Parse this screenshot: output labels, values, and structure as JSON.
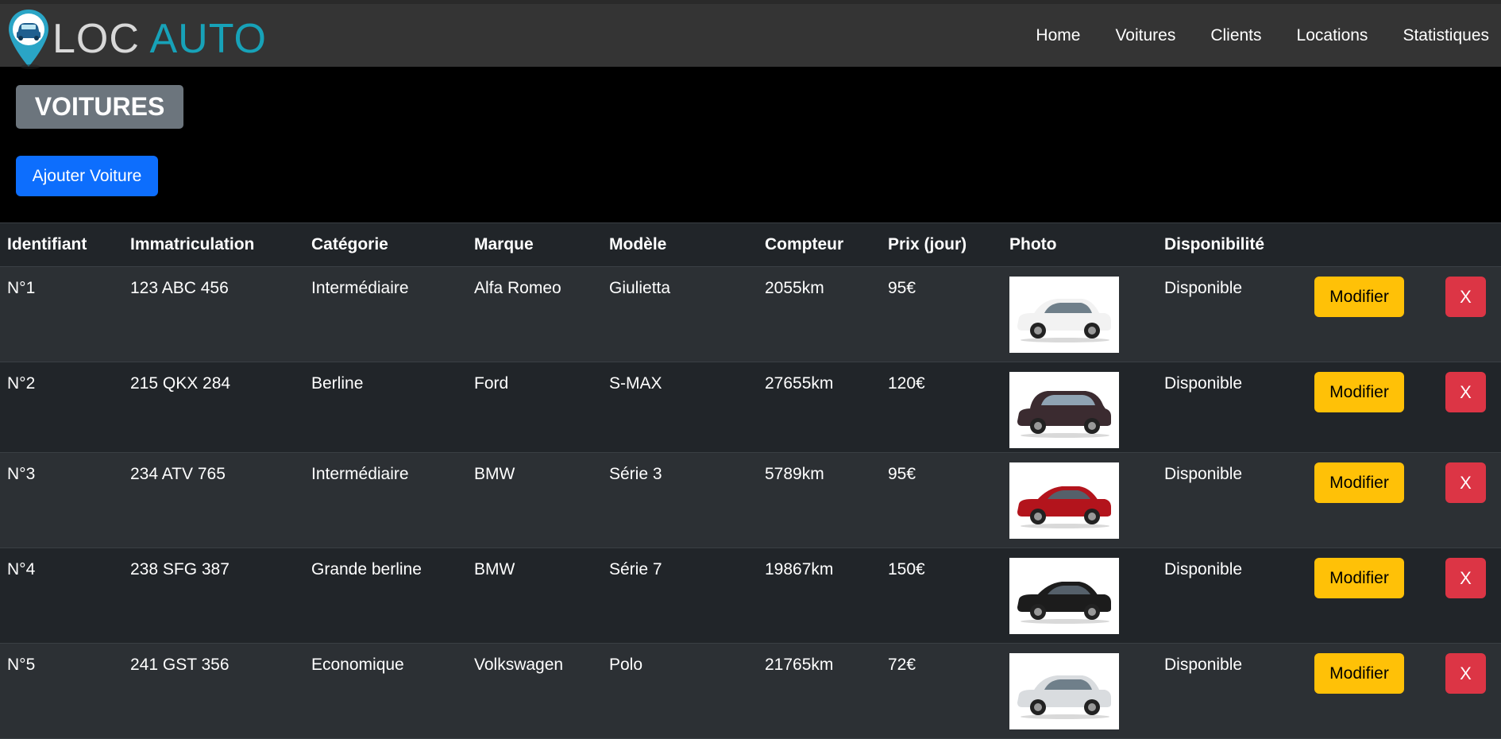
{
  "logo": {
    "word1": "LOC",
    "word2": "AUTO"
  },
  "nav": {
    "items": [
      "Home",
      "Voitures",
      "Clients",
      "Locations",
      "Statistiques"
    ]
  },
  "page": {
    "title": "VOITURES",
    "add_button": "Ajouter Voiture"
  },
  "table": {
    "headers": {
      "id": "Identifiant",
      "plate": "Immatriculation",
      "category": "Catégorie",
      "brand": "Marque",
      "model": "Modèle",
      "mileage": "Compteur",
      "price": "Prix (jour)",
      "photo": "Photo",
      "availability": "Disponibilité"
    },
    "rows": [
      {
        "id": "N°1",
        "plate": "123 ABC 456",
        "category": "Intermédiaire",
        "brand": "Alfa Romeo",
        "model": "Giulietta",
        "mileage": "2055km",
        "price": "95€",
        "availability": "Disponible",
        "edit": "Modifier",
        "delete": "X",
        "car_color": "#f2f2f2",
        "car_shape": "hatch"
      },
      {
        "id": "N°2",
        "plate": "215 QKX 284",
        "category": "Berline",
        "brand": "Ford",
        "model": "S-MAX",
        "mileage": "27655km",
        "price": "120€",
        "availability": "Disponible",
        "edit": "Modifier",
        "delete": "X",
        "car_color": "#3b2b30",
        "car_shape": "mpv"
      },
      {
        "id": "N°3",
        "plate": "234 ATV 765",
        "category": "Intermédiaire",
        "brand": "BMW",
        "model": "Série 3",
        "mileage": "5789km",
        "price": "95€",
        "availability": "Disponible",
        "edit": "Modifier",
        "delete": "X",
        "car_color": "#b3141c",
        "car_shape": "sedan"
      },
      {
        "id": "N°4",
        "plate": "238 SFG 387",
        "category": "Grande berline",
        "brand": "BMW",
        "model": "Série 7",
        "mileage": "19867km",
        "price": "150€",
        "availability": "Disponible",
        "edit": "Modifier",
        "delete": "X",
        "car_color": "#1c1c1c",
        "car_shape": "sedan"
      },
      {
        "id": "N°5",
        "plate": "241 GST 356",
        "category": "Economique",
        "brand": "Volkswagen",
        "model": "Polo",
        "mileage": "21765km",
        "price": "72€",
        "availability": "Disponible",
        "edit": "Modifier",
        "delete": "X",
        "car_color": "#d9dcdf",
        "car_shape": "hatch"
      }
    ]
  },
  "colors": {
    "accent": "#17a2b8",
    "primary": "#0d6efd",
    "warning": "#ffc107",
    "danger": "#dc3545",
    "secondary": "#6c757d"
  }
}
